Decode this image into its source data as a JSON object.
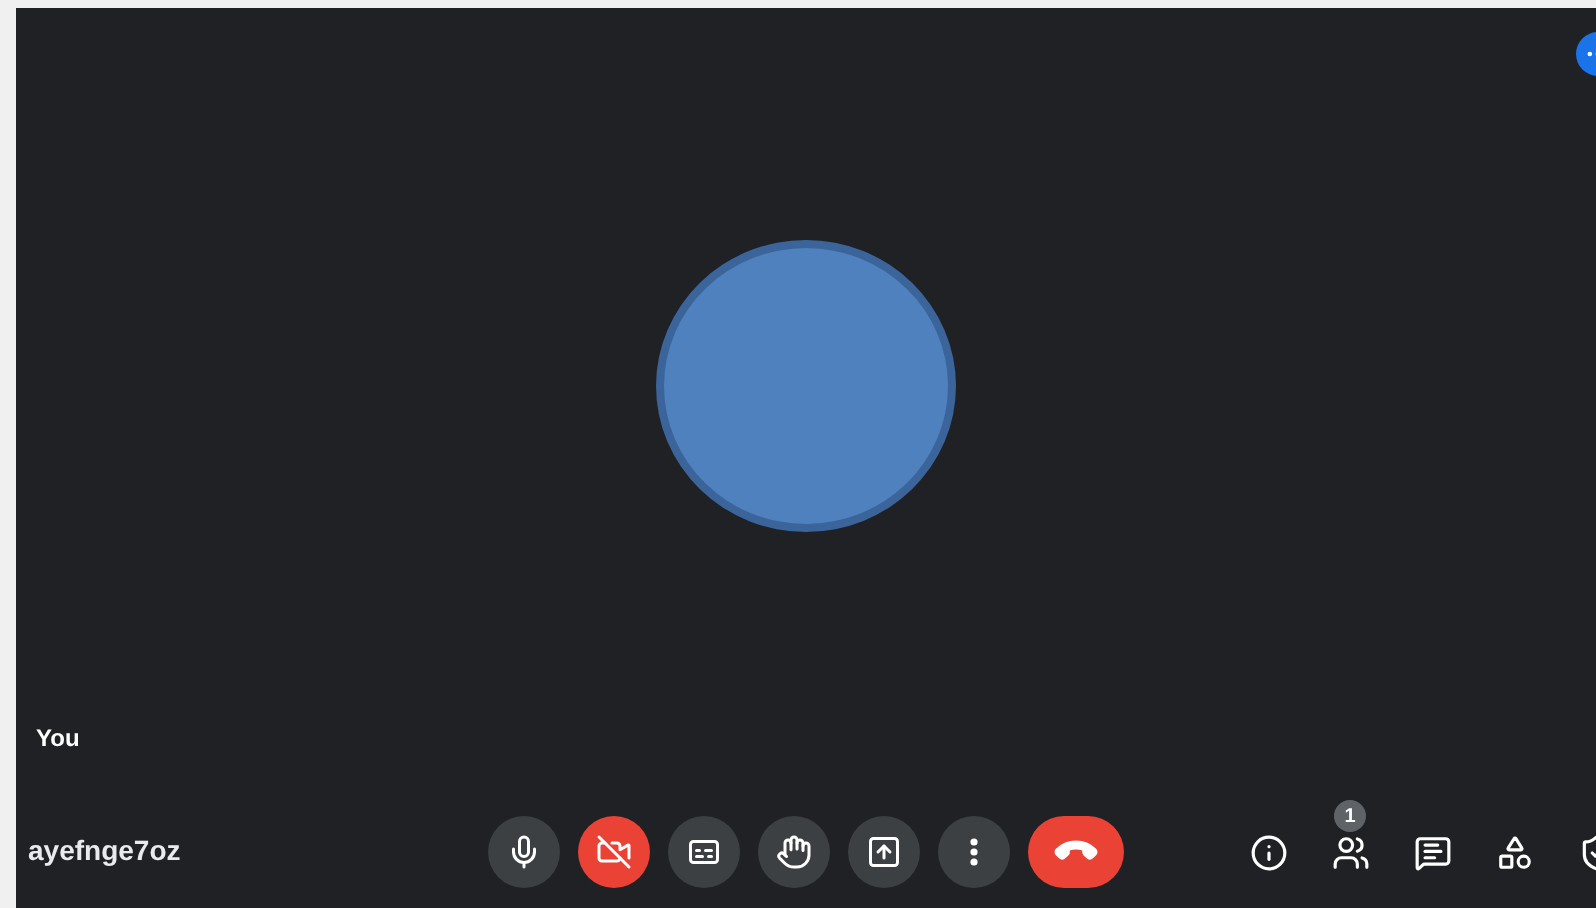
{
  "participant": {
    "label": "You"
  },
  "meeting_code": "ayefnge7oz",
  "controls": [
    {
      "kind": "mic",
      "on": true
    },
    {
      "kind": "camera",
      "on": false
    },
    {
      "kind": "captions"
    },
    {
      "kind": "hand",
      "on": false
    },
    {
      "kind": "present"
    },
    {
      "kind": "more"
    },
    {
      "kind": "leave"
    }
  ],
  "side_tools": [
    {
      "kind": "info"
    },
    {
      "kind": "people",
      "badge": "1"
    },
    {
      "kind": "chat"
    },
    {
      "kind": "activities"
    },
    {
      "kind": "host"
    }
  ]
}
